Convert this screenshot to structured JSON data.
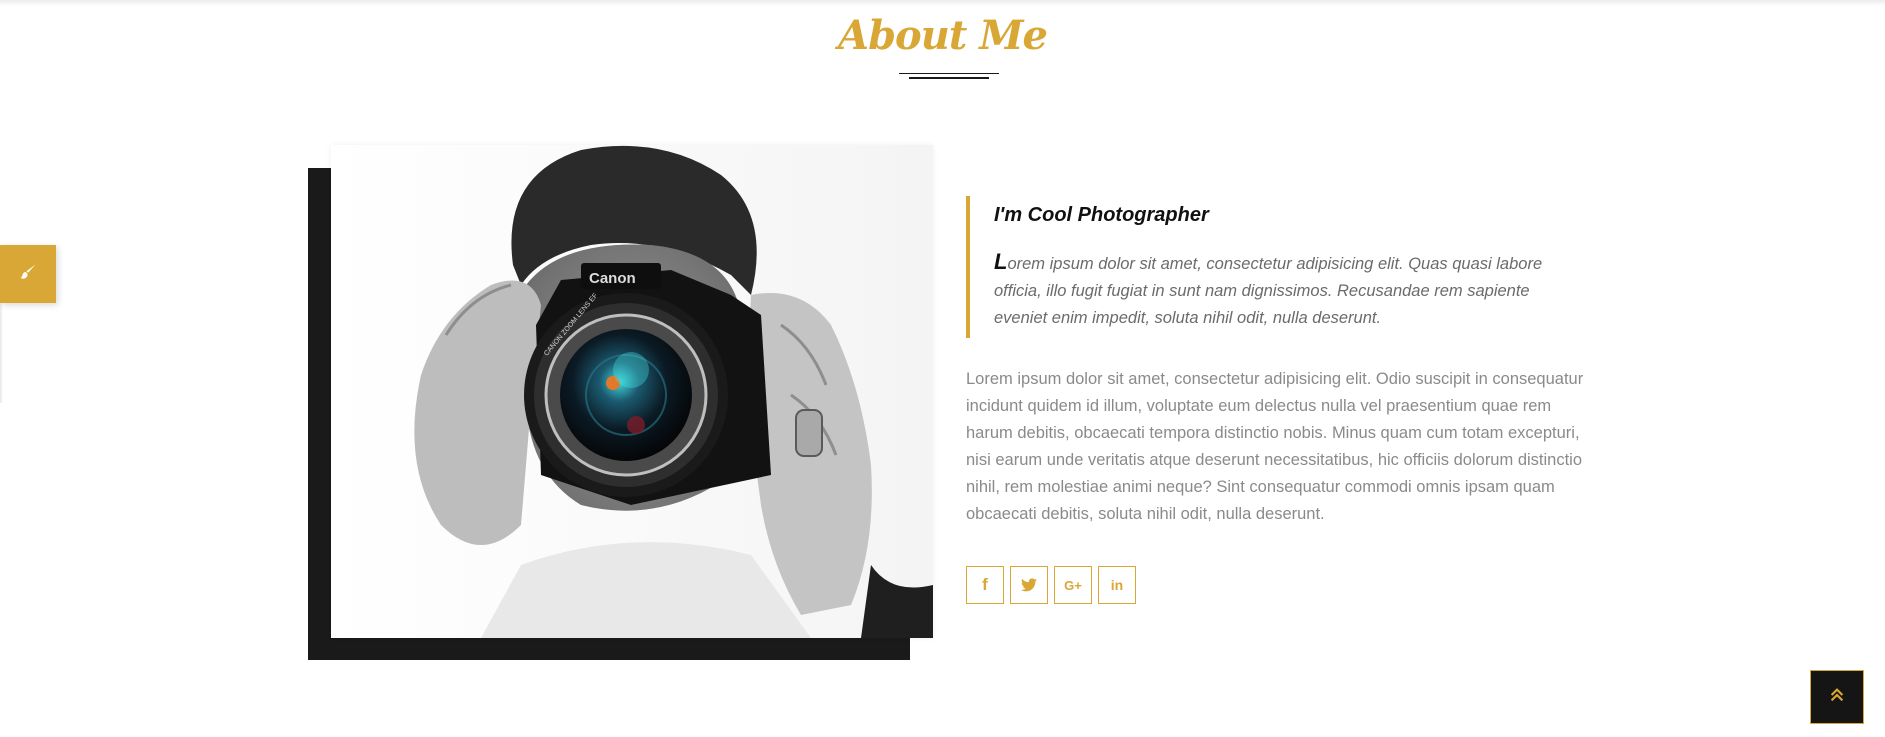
{
  "section": {
    "title": "About Me"
  },
  "about": {
    "heading": "I'm Cool Photographer",
    "quote_dropcap": "L",
    "quote_rest": "orem ipsum dolor sit amet, consectetur adipisicing elit. Quas quasi labore officia, illo fugit fugiat in sunt nam dignissimos. Recusandae rem sapiente eveniet enim impedit, soluta nihil odit, nulla deserunt.",
    "body": "Lorem ipsum dolor sit amet, consectetur adipisicing elit. Odio suscipit in consequatur incidunt quidem id illum, voluptate eum delectus nulla vel praesentium quae rem harum debitis, obcaecati tempora distinctio nobis. Minus quam cum totam excepturi, nisi earum unde veritatis atque deserunt necessitatibus, hic officiis dolorum distinctio nihil, rem molestiae animi neque? Sint consequatur commodi omnis ipsam quam obcaecati debitis, soluta nihil odit, nulla deserunt."
  },
  "social": [
    {
      "icon": "facebook-icon",
      "glyph": "f"
    },
    {
      "icon": "twitter-icon",
      "glyph": ""
    },
    {
      "icon": "google-plus-icon",
      "glyph": "G+"
    },
    {
      "icon": "linkedin-icon",
      "glyph": "in"
    }
  ],
  "colors": {
    "accent": "#d9a735",
    "dark": "#1a1a1a",
    "body_text": "#8a8a8a",
    "quote_text": "#6b6b6b"
  },
  "floating": {
    "customizer_icon": "paint-brush-icon",
    "back_to_top_icon": "double-chevron-up-icon"
  }
}
